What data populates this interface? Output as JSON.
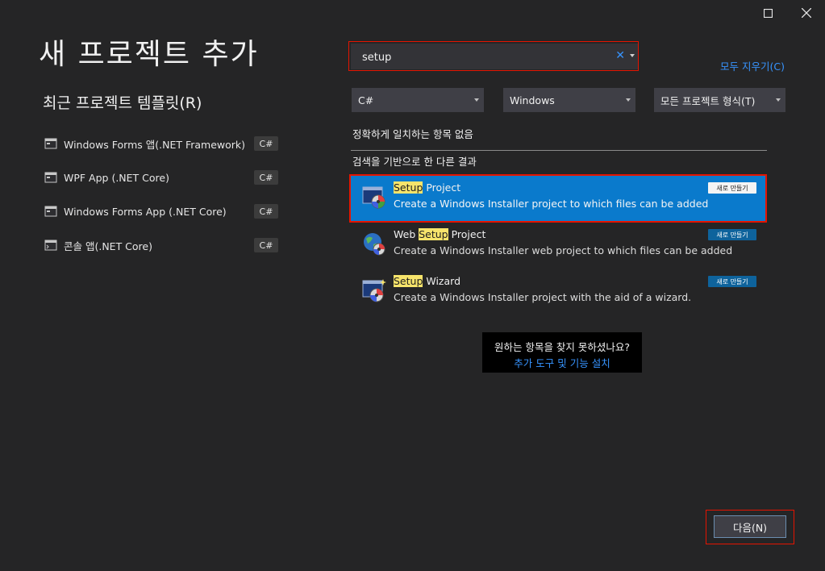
{
  "dialog": {
    "title": "새 프로젝트 추가",
    "recent_heading": "최근 프로젝트 템플릿(R)"
  },
  "recent_templates": [
    {
      "label": "Windows Forms 앱(.NET Framework)",
      "lang": "C#",
      "icon": "form-window-icon"
    },
    {
      "label": "WPF App (.NET Core)",
      "lang": "C#",
      "icon": "form-window-icon"
    },
    {
      "label": "Windows Forms App (.NET Core)",
      "lang": "C#",
      "icon": "form-window-icon"
    },
    {
      "label": "콘솔 앱(.NET Core)",
      "lang": "C#",
      "icon": "console-window-icon"
    }
  ],
  "search": {
    "value": "setup",
    "clear_icon": "close-icon",
    "clear_all": "모두 지우기(C)"
  },
  "filters": {
    "language": "C#",
    "platform": "Windows",
    "project_type": "모든 프로젝트 형식(T)"
  },
  "messages": {
    "no_exact_match": "정확하게 일치하는 항목 없음",
    "other_results": "검색을 기반으로 한 다른 결과"
  },
  "results": [
    {
      "title_pre": "",
      "title_hl": "Setup",
      "title_post": " Project",
      "description": "Create a Windows Installer project to which files can be added",
      "badge": "새로 만들기",
      "selected": true,
      "icon": "setup-project-icon"
    },
    {
      "title_pre": "Web ",
      "title_hl": "Setup",
      "title_post": " Project",
      "description": "Create a Windows Installer web project to which files can be added",
      "badge": "새로 만들기",
      "selected": false,
      "icon": "web-setup-project-icon"
    },
    {
      "title_pre": "",
      "title_hl": "Setup",
      "title_post": " Wizard",
      "description": "Create a Windows Installer project with the aid of a wizard.",
      "badge": "새로 만들기",
      "selected": false,
      "icon": "setup-wizard-icon"
    }
  ],
  "help": {
    "question": "원하는 항목을 찾지 못하셨나요?",
    "link": "추가 도구 및 기능 설치"
  },
  "footer": {
    "next_label": "다음(N)"
  },
  "colors": {
    "background": "#252526",
    "accent": "#0a7acc",
    "link": "#3794ff",
    "highlight": "#f7e46b",
    "annotation_red": "#e51400"
  }
}
